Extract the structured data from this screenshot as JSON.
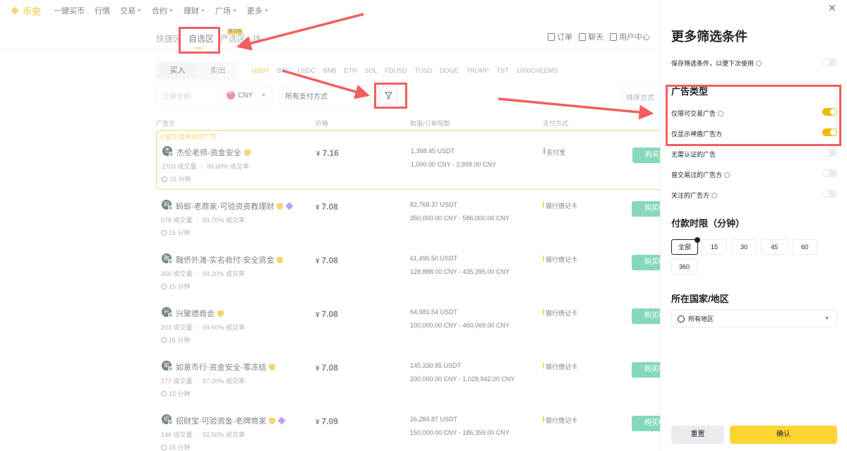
{
  "nav": {
    "logo": "币安",
    "items": [
      {
        "label": "一键买币",
        "caret": false
      },
      {
        "label": "行情",
        "caret": false
      },
      {
        "label": "交易",
        "caret": true
      },
      {
        "label": "合约",
        "caret": true
      },
      {
        "label": "理财",
        "caret": true
      },
      {
        "label": "广场",
        "caret": true
      },
      {
        "label": "更多",
        "caret": true
      }
    ]
  },
  "subheader": {
    "tabs": [
      "快捷区",
      "自选区",
      "严选区",
      "块"
    ],
    "badge": "新上线",
    "right": {
      "orders": "订单",
      "chat": "聊天",
      "user_center": "用户中心"
    }
  },
  "trade": {
    "buy_label": "买入",
    "sell_label": "卖出",
    "coins": [
      "USDT",
      "BTC",
      "USDC",
      "BNB",
      "ETH",
      "SOL",
      "FDUSD",
      "TUSD",
      "DOGE",
      "TRUMP",
      "TST",
      "1000CHEEMS"
    ],
    "amount_placeholder": "交易金额",
    "currency": "CNY",
    "payment_select": "所有支付方式",
    "sort_placeholder": "排序方式"
  },
  "table": {
    "headers": {
      "advertiser": "广告方",
      "price": "价格",
      "quantity": "数量/订单限额",
      "payment": "支付方式"
    },
    "promo_label": "小额交易免除资广告",
    "buy_button": "购买USDT",
    "rows": [
      {
        "avatar": "杰",
        "name": "杰伦老师-资金安全",
        "badges": [
          "shield"
        ],
        "orders": "2703 成交量",
        "rate": "99.00% 成交率",
        "time": "15 分钟",
        "currency_symbol": "¥",
        "price": "7.16",
        "available": "1,398.45 USDT",
        "limit": "1,000.00 CNY - 2,999.00 CNY",
        "payment": "支付宝",
        "payment_type": "alipay"
      },
      {
        "avatar": "蚂",
        "name": "蚂蚁-老商家-可验资资教理财",
        "badges": [
          "shield",
          "diamond"
        ],
        "orders": "576 成交量",
        "rate": "93.70% 成交率",
        "time": "15 分钟",
        "currency_symbol": "¥",
        "price": "7.08",
        "available": "82,768.37 USDT",
        "limit": "350,000.00 CNY - 586,000.00 CNY",
        "payment": "银行借记卡",
        "payment_type": "bank"
      },
      {
        "avatar": "融",
        "name": "融侨外滩-实名收付-安全资金",
        "badges": [
          "shield"
        ],
        "orders": "356 成交量",
        "rate": "93.20% 成交率",
        "time": "15 分钟",
        "currency_symbol": "¥",
        "price": "7.08",
        "available": "61,496.50 USDT",
        "limit": "128,888.00 CNY - 435,395.00 CNY",
        "payment": "银行借记卡",
        "payment_type": "bank"
      },
      {
        "avatar": "兴",
        "name": "兴聚德商会",
        "badges": [
          "shield"
        ],
        "orders": "203 成交量",
        "rate": "99.60% 成交率",
        "time": "15 分钟",
        "currency_symbol": "¥",
        "price": "7.08",
        "available": "64,981.54 USDT",
        "limit": "100,000.00 CNY - 460,069.00 CNY",
        "payment": "银行借记卡",
        "payment_type": "bank"
      },
      {
        "avatar": "如",
        "name": "如意币行-资金安全-零冻结",
        "badges": [
          "shield"
        ],
        "orders": "277 成交量",
        "rate": "97.20% 成交率",
        "time": "15 分钟",
        "currency_symbol": "¥",
        "price": "7.08",
        "available": "145,330.85 USDT",
        "limit": "200,000.00 CNY - 1,028,942.00 CNY",
        "payment": "银行借记卡",
        "payment_type": "bank"
      },
      {
        "avatar": "招",
        "name": "招财宝-可验资金-老牌商家",
        "badges": [
          "shield",
          "diamond"
        ],
        "orders": "146 成交量",
        "rate": "92.50% 成交率",
        "time": "15 分钟",
        "currency_symbol": "¥",
        "price": "7.09",
        "available": "26,284.87 USDT",
        "limit": "150,000.00 CNY - 186,359.00 CNY",
        "payment": "银行借记卡",
        "payment_type": "bank"
      }
    ]
  },
  "panel": {
    "title": "更多筛选条件",
    "save_filter": "保存筛选条件，以便下次使用",
    "ad_type_title": "广告类型",
    "options": [
      {
        "label": "仅限可交易广告",
        "info": true,
        "on": true
      },
      {
        "label": "仅显示神盾广告方",
        "info": false,
        "on": true
      },
      {
        "label": "无需认证的广告",
        "info": false,
        "on": false
      },
      {
        "label": "曾交易过的广告方",
        "info": true,
        "on": false
      },
      {
        "label": "关注的广告方",
        "info": true,
        "on": false
      }
    ],
    "payment_time_title": "付款时限（分钟）",
    "time_chips": [
      "全部",
      "15",
      "30",
      "45",
      "60",
      "360"
    ],
    "region_title": "所在国家/地区",
    "region_value": "所有地区",
    "reset_label": "重置",
    "confirm_label": "确认"
  },
  "colors": {
    "accent": "#f0b90b",
    "buy": "#2ebd85",
    "annotation": "#f25f5f",
    "confirm": "#fcd535"
  }
}
